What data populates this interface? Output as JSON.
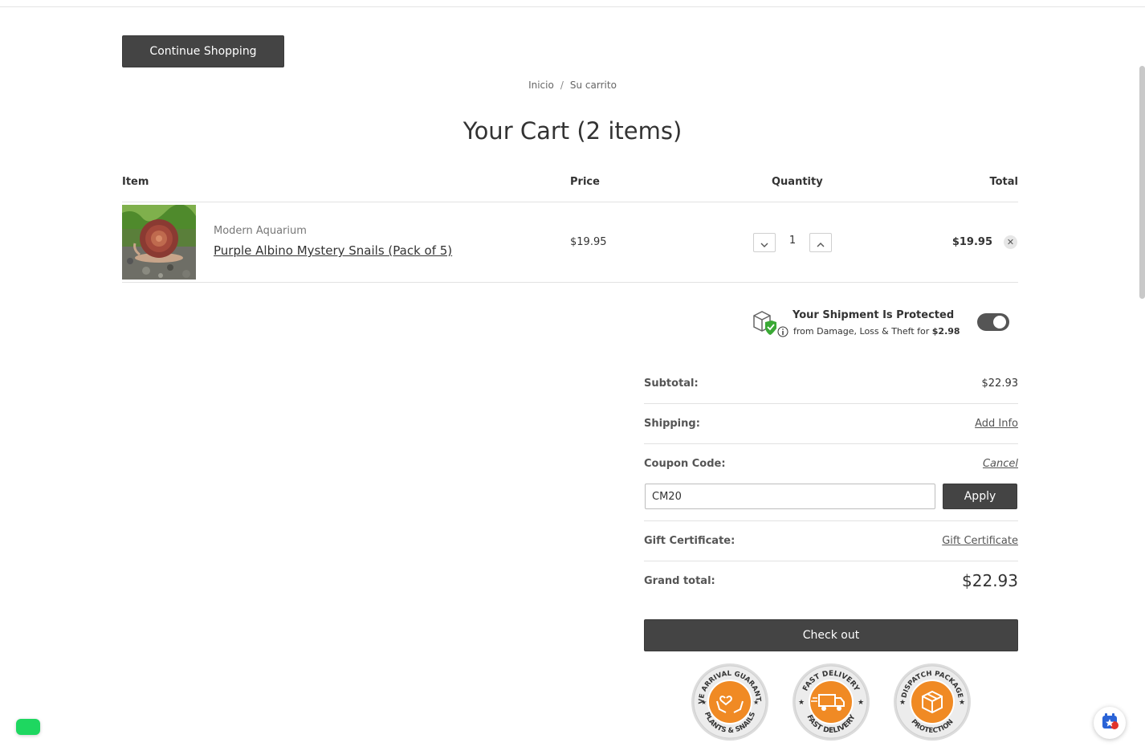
{
  "header": {
    "continue_label": "Continue Shopping"
  },
  "breadcrumb": {
    "home": "Inicio",
    "separator": "/",
    "current": "Su carrito"
  },
  "cart": {
    "title": "Your Cart (2 items)"
  },
  "table": {
    "headers": {
      "item": "Item",
      "price": "Price",
      "quantity": "Quantity",
      "total": "Total"
    },
    "rows": [
      {
        "brand": "Modern Aquarium",
        "name": "Purple Albino Mystery Snails (Pack of 5)",
        "image_icon": "snail-product-image",
        "price": "$19.95",
        "quantity": "1",
        "total": "$19.95"
      }
    ]
  },
  "protection": {
    "title": "Your Shipment Is Protected",
    "sub_prefix": "from Damage, Loss & Theft for",
    "amount": "$2.98",
    "enabled": true
  },
  "summary": {
    "subtotal_label": "Subtotal:",
    "subtotal_value": "$22.93",
    "shipping_label": "Shipping:",
    "shipping_link": "Add Info",
    "coupon_label": "Coupon Code:",
    "coupon_cancel": "Cancel",
    "coupon_value": "CM20",
    "apply_label": "Apply",
    "gift_label": "Gift Certificate:",
    "gift_link": "Gift Certificate",
    "grand_label": "Grand total:",
    "grand_value": "$22.93",
    "checkout_label": "Check out"
  },
  "badges": [
    {
      "top_text": "LIVE ARRIVAL GUARANTEE",
      "bottom_text": "PLANTS & SNAILS",
      "icon": "hands-heart-icon"
    },
    {
      "top_text": "FAST DELIVERY",
      "bottom_text": "FAST DELIVERY",
      "icon": "delivery-truck-icon"
    },
    {
      "top_text": "DISPATCH PACKAGE",
      "bottom_text": "PROTECTION",
      "icon": "package-protection-icon"
    }
  ],
  "colors": {
    "button_dark": "#444444",
    "badge_orange": "#f08a24",
    "protect_green": "#3aa935",
    "chat_green": "#1ed760"
  }
}
